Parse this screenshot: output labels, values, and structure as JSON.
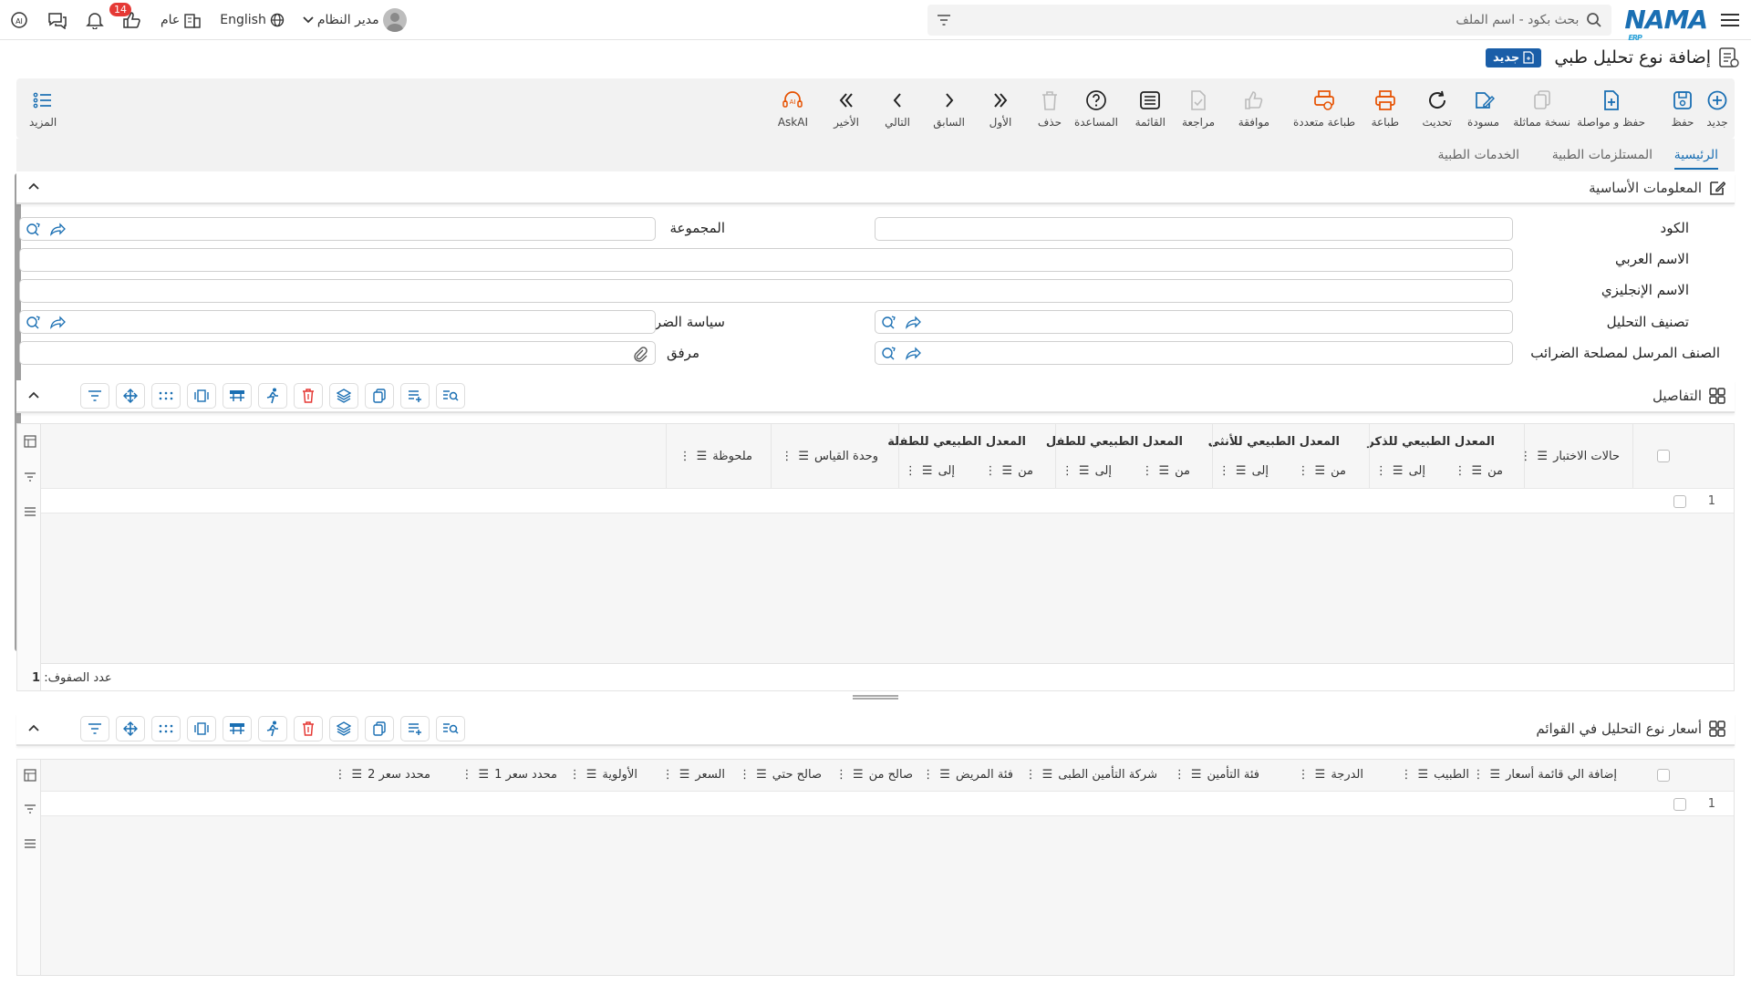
{
  "topbar": {
    "logo": "NAMA",
    "logo_sub": "ERP",
    "search_placeholder": "بحث بكود - اسم الملف",
    "language": "English",
    "scope": "عام",
    "notification_count": "14",
    "user": "مدير النظام"
  },
  "page": {
    "title": "إضافة نوع تحليل طبي",
    "mode_badge": "جديد"
  },
  "toolbar": {
    "new": "جديد",
    "save": "حفظ",
    "save_continue": "حفظ و مواصلة",
    "copy": "نسخة مماثلة",
    "draft": "مسودة",
    "refresh": "تحديث",
    "print": "طباعة",
    "multi_print": "طباعة متعددة",
    "approve": "موافقة",
    "review": "مراجعة",
    "list": "القائمة",
    "help": "المساعدة",
    "delete": "حذف",
    "first": "الأول",
    "previous": "السابق",
    "next": "التالي",
    "last": "الأخير",
    "askai": "AskAI",
    "more": "المزيد"
  },
  "tabs": [
    "الرئيسية",
    "المستلزمات الطبية",
    "الخدمات الطبية"
  ],
  "basic": {
    "title": "المعلومات الأساسية",
    "code": "الكود",
    "group": "المجموعة",
    "arabic_name": "الاسم العربي",
    "english_name": "الاسم الإنجليزي",
    "classification": "تصنيف التحليل",
    "tax_policy": "سياسة الضريبة",
    "tax_item": "الصنف المرسل لمصلحة الضرائب",
    "attachment": "مرفق"
  },
  "details": {
    "title": "التفاصيل",
    "col_test_states": "حالات الاختبار",
    "col_male": "المعدل الطبيعي للذكر",
    "col_female": "المعدل الطبيعي للأنثى",
    "col_child": "المعدل الطبيعي للطفل",
    "col_girl": "المعدل الطبيعي للطفلة",
    "from": "من",
    "to": "إلى",
    "col_unit": "وحدة القياس",
    "col_note": "ملحوظة",
    "row_number": "1",
    "row_count_label": "عدد الصفوف:",
    "row_count": "1"
  },
  "prices": {
    "title": "أسعار نوع التحليل في القوائم",
    "columns": [
      "إضافة الي قائمة أسعار",
      "الطبيب",
      "الدرجة",
      "فئة التأمين",
      "شركة التأمين الطبى",
      "فئة المريض",
      "صالح من",
      "صالح حتي",
      "السعر",
      "الأولوية",
      "محدد سعر 1",
      "محدد سعر 2"
    ],
    "row_number": "1"
  }
}
